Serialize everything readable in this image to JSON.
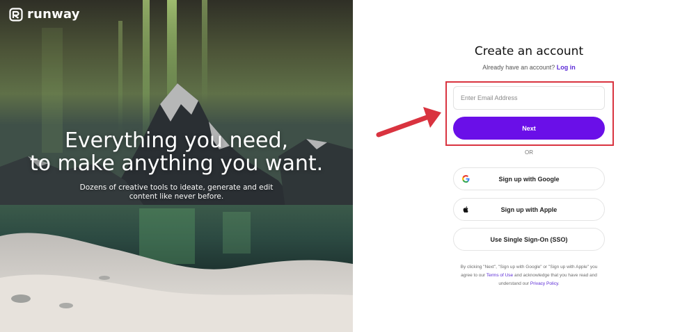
{
  "brand": {
    "name": "runway"
  },
  "hero": {
    "headline_line1": "Everything you need,",
    "headline_line2": "to make anything you want.",
    "sub_line1": "Dozens of creative tools to ideate, generate and edit",
    "sub_line2": "content like never before."
  },
  "form": {
    "title": "Create an account",
    "have_account": "Already have an account?",
    "login_link": "Log in",
    "email_placeholder": "Enter Email Address",
    "email_value": "",
    "next_label": "Next",
    "or_label": "OR",
    "google_label": "Sign up with Google",
    "apple_label": "Sign up with Apple",
    "sso_label": "Use Single Sign-On (SSO)"
  },
  "terms": {
    "part1": "By clicking \"Next\", \"Sign up with Google\" or \"Sign up with Apple\" you",
    "part2a": "agree to our ",
    "terms_link": "Terms of Use",
    "part2b": " and acknowledge that you have read and",
    "part3a": "understand our ",
    "privacy_link": "Privacy Policy",
    "part3b": "."
  },
  "colors": {
    "accent": "#6a0fe8",
    "link": "#5b2ad6",
    "annotation": "#d9333f"
  },
  "icons": {
    "logo": "runway-logo-icon",
    "google": "google-icon",
    "apple": "apple-icon",
    "arrow": "annotation-arrow-icon"
  }
}
